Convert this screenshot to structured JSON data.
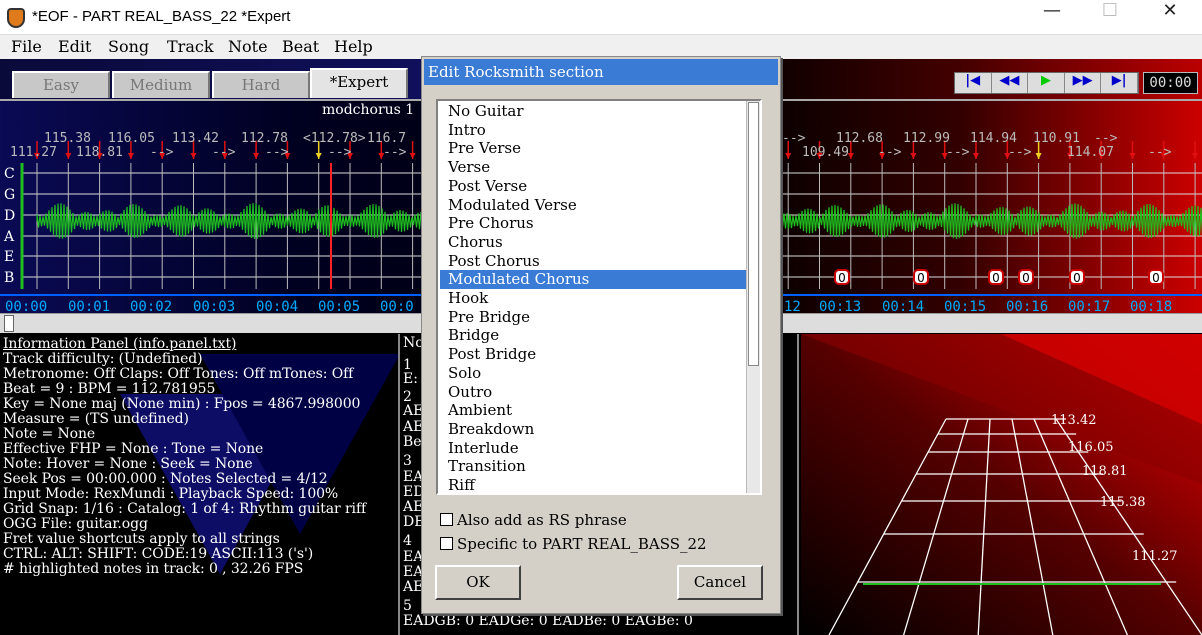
{
  "window": {
    "title": "*EOF - PART REAL_BASS_22  *Expert",
    "minimize": "—",
    "maximize": "☐",
    "close": "✕"
  },
  "menu": [
    "File",
    "Edit",
    "Song",
    "Track",
    "Note",
    "Beat",
    "Help"
  ],
  "difficulty_tabs": [
    {
      "label": "Easy",
      "active": false
    },
    {
      "label": "Medium",
      "active": false
    },
    {
      "label": "Hard",
      "active": false
    },
    {
      "label": "*Expert",
      "active": true
    }
  ],
  "transport": {
    "buttons": [
      "|◀",
      "◀◀",
      "▶",
      "▶▶",
      "▶|"
    ],
    "timecode": "00:00"
  },
  "editor": {
    "section_label": "modchorus 1",
    "string_labels": [
      "C",
      "G",
      "D",
      "A",
      "E",
      "B"
    ],
    "tempo_row1": [
      "115.38",
      "116.05",
      "113.42",
      "112.78",
      "<112.78>",
      "116.7",
      "-->",
      "112.68",
      "112.99",
      "114.94",
      "110.91",
      "-->"
    ],
    "tempo_row2": [
      "111.27",
      "118.81",
      "-->",
      "-->",
      "-->",
      "-->",
      "-->",
      "109.49",
      "-->",
      "-->",
      "-->",
      "114.07",
      "-->"
    ],
    "time_labels": [
      "00:00",
      "00:01",
      "00:02",
      "00:03",
      "00:04",
      "00:05",
      "00:0",
      "12",
      "00:13",
      "00:14",
      "00:15",
      "00:16",
      "00:17",
      "00:18"
    ],
    "note_marker": "0"
  },
  "info_panel": {
    "lines": [
      "Information Panel (info.panel.txt)",
      "Track difficulty: (Undefined)",
      "Metronome: Off Claps: Off Tones: Off mTones: Off",
      "Beat = 9 : BPM = 112.781955",
      "Key = None maj (None min) : Fpos = 4867.998000",
      "Measure = (TS undefined)",
      "Note = None",
      "Effective FHP = None : Tone = None",
      "Note: Hover = None : Seek = None",
      "Seek Pos = 00:00.000 : Notes Selected = 4/12",
      "Input Mode: RexMundi : Playback Speed: 100%",
      "Grid Snap: 1/16 : Catalog: 1 of 4: Rhythm guitar riff",
      "OGG File: guitar.ogg",
      "Fret value shortcuts apply to all strings",
      "CTRL:   ALT:   SHIFT:   CODE:19  ASCII:113 ('s')",
      "# highlighted notes in track: 0 , 32.26 FPS"
    ]
  },
  "notes_panel": {
    "lines": [
      "No",
      "1",
      "E:",
      "2",
      "AE",
      "AE",
      "Be",
      "3",
      "EA",
      "ED",
      "AE",
      "DE",
      "4",
      "EA",
      "EA",
      "AE",
      "5",
      "EADGB: 0 EADGe: 0 EADBe: 0 EAGBe: 0"
    ]
  },
  "fretboard": {
    "tempo_labels": [
      "113.42",
      "116.05",
      "118.81",
      "115.38",
      "111.27"
    ]
  },
  "dialog": {
    "title": "Edit Rocksmith section",
    "sections": [
      "No Guitar",
      "Intro",
      "Pre Verse",
      "Verse",
      "Post Verse",
      "Modulated Verse",
      "Pre Chorus",
      "Chorus",
      "Post Chorus",
      "Modulated Chorus",
      "Hook",
      "Pre Bridge",
      "Bridge",
      "Post Bridge",
      "Solo",
      "Outro",
      "Ambient",
      "Breakdown",
      "Interlude",
      "Transition",
      "Riff"
    ],
    "selected_section": "Modulated Chorus",
    "checkbox_phrase": "Also add as RS phrase",
    "checkbox_specific": "Specific to PART REAL_BASS_22",
    "ok_label": "OK",
    "cancel_label": "Cancel"
  },
  "colors": {
    "selection": "#3a7bd5",
    "waveform": "#1fbf1f",
    "beat_marker": "#e01010",
    "time_label": "#00aaff"
  }
}
